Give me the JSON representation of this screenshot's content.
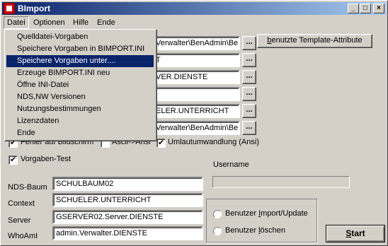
{
  "window": {
    "title": "BImport"
  },
  "menubar": [
    {
      "label": "Datei"
    },
    {
      "label": "Optionen"
    },
    {
      "label": "Hilfe"
    },
    {
      "label": "Ende"
    }
  ],
  "menu": {
    "items": [
      "Quelldatei-Vorgaben",
      "Speichere Vorgaben in BIMPORT.INI",
      "Speichere Vorgaben unter....",
      "Erzeuge BIMPORT.INI neu",
      "Öffne INI-Datei",
      "NDS,NW Versionen",
      "Nutzungsbestimmungen",
      "Lizenzdaten",
      "Ende"
    ],
    "highlighted_index": 2
  },
  "paths": {
    "row1": "Verwalter\\BenAdmin\\Be",
    "row2": "T",
    "row3": "VER.DIENSTE",
    "row4": "",
    "row5": "ELER.UNTERRICHT",
    "row6": "Verwalter\\BenAdmin\\Be"
  },
  "buttons": {
    "dots": "...",
    "template_attrs": "benutzte Template-Attribute",
    "start": "Start"
  },
  "checkboxes": {
    "fehler": "Fehler auf Bildschirm",
    "ascii": "Ascii->Ansi",
    "umlaut": "Umlautumwandlung (Ansi)",
    "vorgaben_test": "Vorgaben-Test"
  },
  "username_label": "Username",
  "form": {
    "nds_baum": {
      "label": "NDS-Baum",
      "value": "SCHULBAUM02"
    },
    "context": {
      "label": "Context",
      "value": "SCHUELER.UNTERRICHT"
    },
    "server": {
      "label": "Server",
      "value": "GSERVER02.Server.DIENSTE"
    },
    "whoami": {
      "label": "WhoAmI",
      "value": "admin.Verwalter.DIENSTE"
    }
  },
  "radios": {
    "import_update": "Benutzer Import/Update",
    "loeschen": "Benutzer löschen"
  }
}
